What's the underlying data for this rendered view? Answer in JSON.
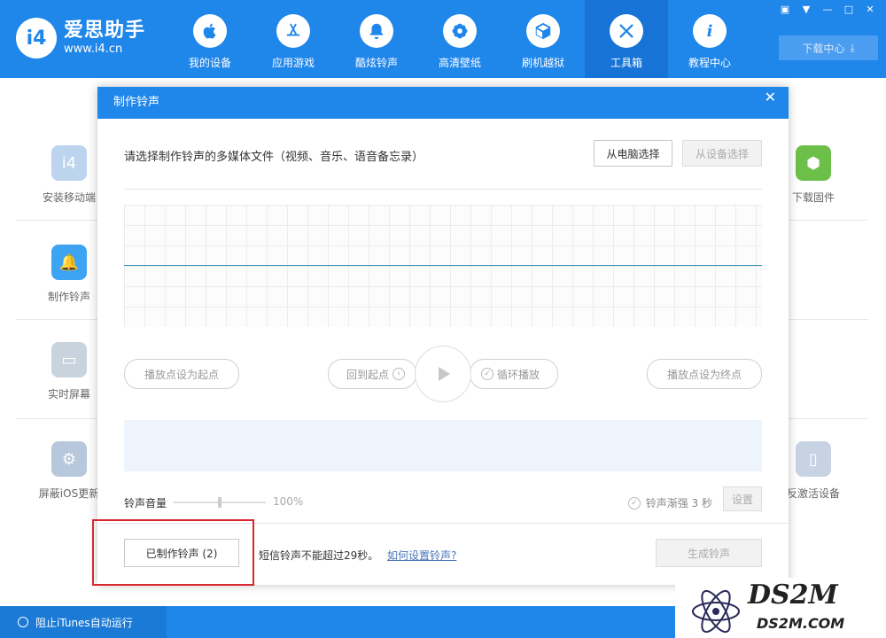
{
  "app": {
    "brand_name": "爱思助手",
    "brand_url": "www.i4.cn",
    "logo_text": "i4"
  },
  "nav": {
    "items": [
      {
        "label": "我的设备",
        "icon": "apple-icon"
      },
      {
        "label": "应用游戏",
        "icon": "appstore-icon"
      },
      {
        "label": "酷炫铃声",
        "icon": "bell-icon"
      },
      {
        "label": "高清壁纸",
        "icon": "flower-icon"
      },
      {
        "label": "刷机越狱",
        "icon": "box-icon"
      },
      {
        "label": "工具箱",
        "icon": "tools-icon",
        "active": true
      },
      {
        "label": "教程中心",
        "icon": "info-icon"
      }
    ]
  },
  "window": {
    "download_center": "下载中心"
  },
  "background_tools": {
    "left": [
      "安装移动端",
      "制作铃声",
      "实时屏幕",
      "屏蔽iOS更新"
    ],
    "right": [
      "下载固件",
      "反激活设备"
    ]
  },
  "bottom_bar": {
    "itunes_toggle": "阻止iTunes自动运行"
  },
  "modal": {
    "title": "制作铃声",
    "prompt": "请选择制作铃声的多媒体文件（视频、音乐、语音备忘录）",
    "from_pc": "从电脑选择",
    "from_device": "从设备选择",
    "set_start": "播放点设为起点",
    "back_to_start": "回到起点",
    "loop_play": "循环播放",
    "set_end": "播放点设为终点",
    "volume_label": "铃声音量",
    "volume_value": "100%",
    "fade_in": "铃声渐强 3 秒",
    "settings": "设置",
    "made_ringtones": "已制作铃声 (2)",
    "note": "短信铃声不能超过29秒。",
    "help_link": "如何设置铃声?",
    "generate": "生成铃声"
  },
  "watermark": {
    "text": "DS2M",
    "url": "DS2M.COM"
  },
  "colors": {
    "primary": "#1f86ea",
    "active_nav": "#1773d5",
    "highlight_box": "#d9262e"
  }
}
